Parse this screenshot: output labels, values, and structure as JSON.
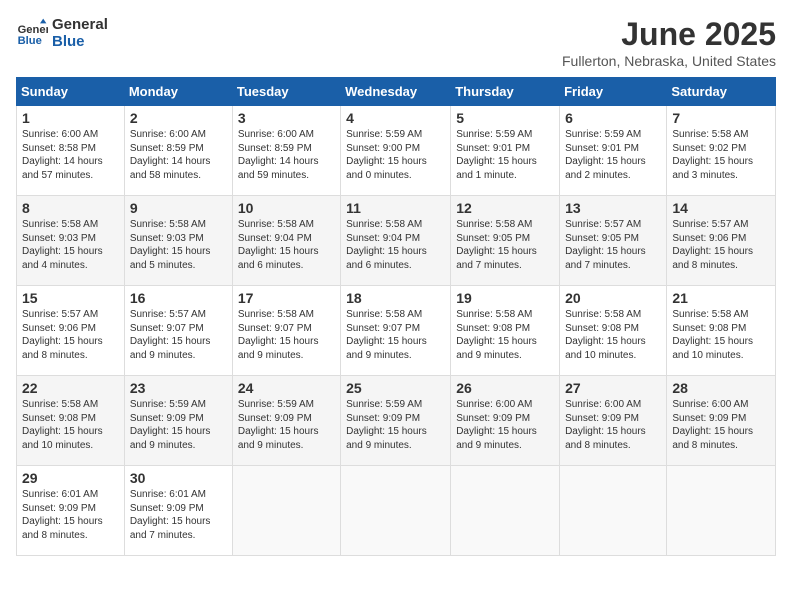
{
  "logo": {
    "line1": "General",
    "line2": "Blue"
  },
  "title": "June 2025",
  "subtitle": "Fullerton, Nebraska, United States",
  "headers": [
    "Sunday",
    "Monday",
    "Tuesday",
    "Wednesday",
    "Thursday",
    "Friday",
    "Saturday"
  ],
  "weeks": [
    [
      {
        "day": "1",
        "info": "Sunrise: 6:00 AM\nSunset: 8:58 PM\nDaylight: 14 hours\nand 57 minutes."
      },
      {
        "day": "2",
        "info": "Sunrise: 6:00 AM\nSunset: 8:59 PM\nDaylight: 14 hours\nand 58 minutes."
      },
      {
        "day": "3",
        "info": "Sunrise: 6:00 AM\nSunset: 8:59 PM\nDaylight: 14 hours\nand 59 minutes."
      },
      {
        "day": "4",
        "info": "Sunrise: 5:59 AM\nSunset: 9:00 PM\nDaylight: 15 hours\nand 0 minutes."
      },
      {
        "day": "5",
        "info": "Sunrise: 5:59 AM\nSunset: 9:01 PM\nDaylight: 15 hours\nand 1 minute."
      },
      {
        "day": "6",
        "info": "Sunrise: 5:59 AM\nSunset: 9:01 PM\nDaylight: 15 hours\nand 2 minutes."
      },
      {
        "day": "7",
        "info": "Sunrise: 5:58 AM\nSunset: 9:02 PM\nDaylight: 15 hours\nand 3 minutes."
      }
    ],
    [
      {
        "day": "8",
        "info": "Sunrise: 5:58 AM\nSunset: 9:03 PM\nDaylight: 15 hours\nand 4 minutes."
      },
      {
        "day": "9",
        "info": "Sunrise: 5:58 AM\nSunset: 9:03 PM\nDaylight: 15 hours\nand 5 minutes."
      },
      {
        "day": "10",
        "info": "Sunrise: 5:58 AM\nSunset: 9:04 PM\nDaylight: 15 hours\nand 6 minutes."
      },
      {
        "day": "11",
        "info": "Sunrise: 5:58 AM\nSunset: 9:04 PM\nDaylight: 15 hours\nand 6 minutes."
      },
      {
        "day": "12",
        "info": "Sunrise: 5:58 AM\nSunset: 9:05 PM\nDaylight: 15 hours\nand 7 minutes."
      },
      {
        "day": "13",
        "info": "Sunrise: 5:57 AM\nSunset: 9:05 PM\nDaylight: 15 hours\nand 7 minutes."
      },
      {
        "day": "14",
        "info": "Sunrise: 5:57 AM\nSunset: 9:06 PM\nDaylight: 15 hours\nand 8 minutes."
      }
    ],
    [
      {
        "day": "15",
        "info": "Sunrise: 5:57 AM\nSunset: 9:06 PM\nDaylight: 15 hours\nand 8 minutes."
      },
      {
        "day": "16",
        "info": "Sunrise: 5:57 AM\nSunset: 9:07 PM\nDaylight: 15 hours\nand 9 minutes."
      },
      {
        "day": "17",
        "info": "Sunrise: 5:58 AM\nSunset: 9:07 PM\nDaylight: 15 hours\nand 9 minutes."
      },
      {
        "day": "18",
        "info": "Sunrise: 5:58 AM\nSunset: 9:07 PM\nDaylight: 15 hours\nand 9 minutes."
      },
      {
        "day": "19",
        "info": "Sunrise: 5:58 AM\nSunset: 9:08 PM\nDaylight: 15 hours\nand 9 minutes."
      },
      {
        "day": "20",
        "info": "Sunrise: 5:58 AM\nSunset: 9:08 PM\nDaylight: 15 hours\nand 10 minutes."
      },
      {
        "day": "21",
        "info": "Sunrise: 5:58 AM\nSunset: 9:08 PM\nDaylight: 15 hours\nand 10 minutes."
      }
    ],
    [
      {
        "day": "22",
        "info": "Sunrise: 5:58 AM\nSunset: 9:08 PM\nDaylight: 15 hours\nand 10 minutes."
      },
      {
        "day": "23",
        "info": "Sunrise: 5:59 AM\nSunset: 9:09 PM\nDaylight: 15 hours\nand 9 minutes."
      },
      {
        "day": "24",
        "info": "Sunrise: 5:59 AM\nSunset: 9:09 PM\nDaylight: 15 hours\nand 9 minutes."
      },
      {
        "day": "25",
        "info": "Sunrise: 5:59 AM\nSunset: 9:09 PM\nDaylight: 15 hours\nand 9 minutes."
      },
      {
        "day": "26",
        "info": "Sunrise: 6:00 AM\nSunset: 9:09 PM\nDaylight: 15 hours\nand 9 minutes."
      },
      {
        "day": "27",
        "info": "Sunrise: 6:00 AM\nSunset: 9:09 PM\nDaylight: 15 hours\nand 8 minutes."
      },
      {
        "day": "28",
        "info": "Sunrise: 6:00 AM\nSunset: 9:09 PM\nDaylight: 15 hours\nand 8 minutes."
      }
    ],
    [
      {
        "day": "29",
        "info": "Sunrise: 6:01 AM\nSunset: 9:09 PM\nDaylight: 15 hours\nand 8 minutes."
      },
      {
        "day": "30",
        "info": "Sunrise: 6:01 AM\nSunset: 9:09 PM\nDaylight: 15 hours\nand 7 minutes."
      },
      null,
      null,
      null,
      null,
      null
    ]
  ]
}
